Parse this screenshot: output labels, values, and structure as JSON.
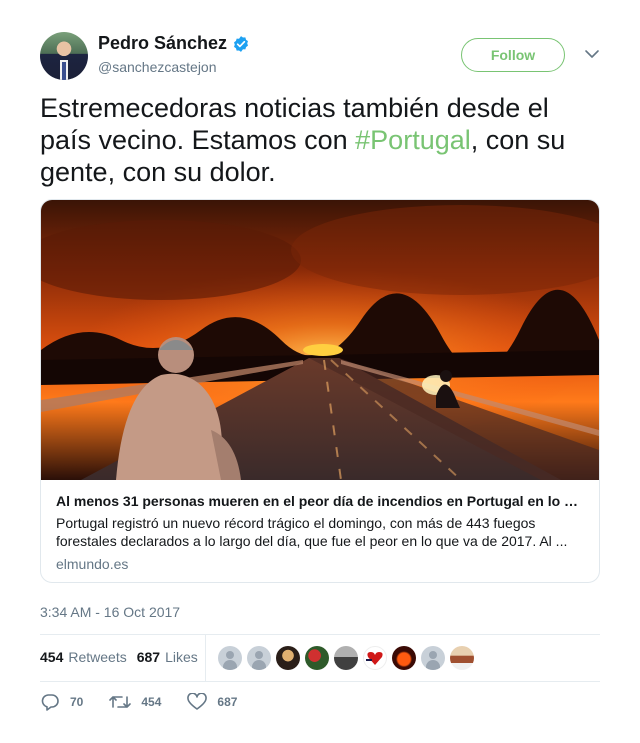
{
  "user": {
    "name": "Pedro Sánchez",
    "handle": "@sanchezcastejon",
    "verified": true
  },
  "follow_label": "Follow",
  "tweet": {
    "text_before": "Estremecedoras noticias también desde el país vecino. Estamos con ",
    "hashtag": "#Portugal",
    "text_after": ", con su gente, con su dolor."
  },
  "card": {
    "title": "Al menos 31 personas mueren en el peor día de incendios en Portugal en lo …",
    "description": "Portugal registró un nuevo récord trágico el domingo, con más de 443 fuegos forestales declarados a lo largo del día, que fue el peor en lo que va de 2017. Al ...",
    "domain": "elmundo.es"
  },
  "timestamp": "3:34 AM - 16 Oct 2017",
  "stats": {
    "retweets_count": "454",
    "retweets_label": "Retweets",
    "likes_count": "687",
    "likes_label": "Likes"
  },
  "actions": {
    "replies": "70",
    "retweets": "454",
    "likes": "687"
  },
  "colors": {
    "accent": "#79c473",
    "verified": "#1da1f2",
    "muted": "#657786"
  },
  "icons": [
    "verified-badge-icon",
    "chevron-down-icon",
    "reply-icon",
    "retweet-icon",
    "heart-icon"
  ]
}
